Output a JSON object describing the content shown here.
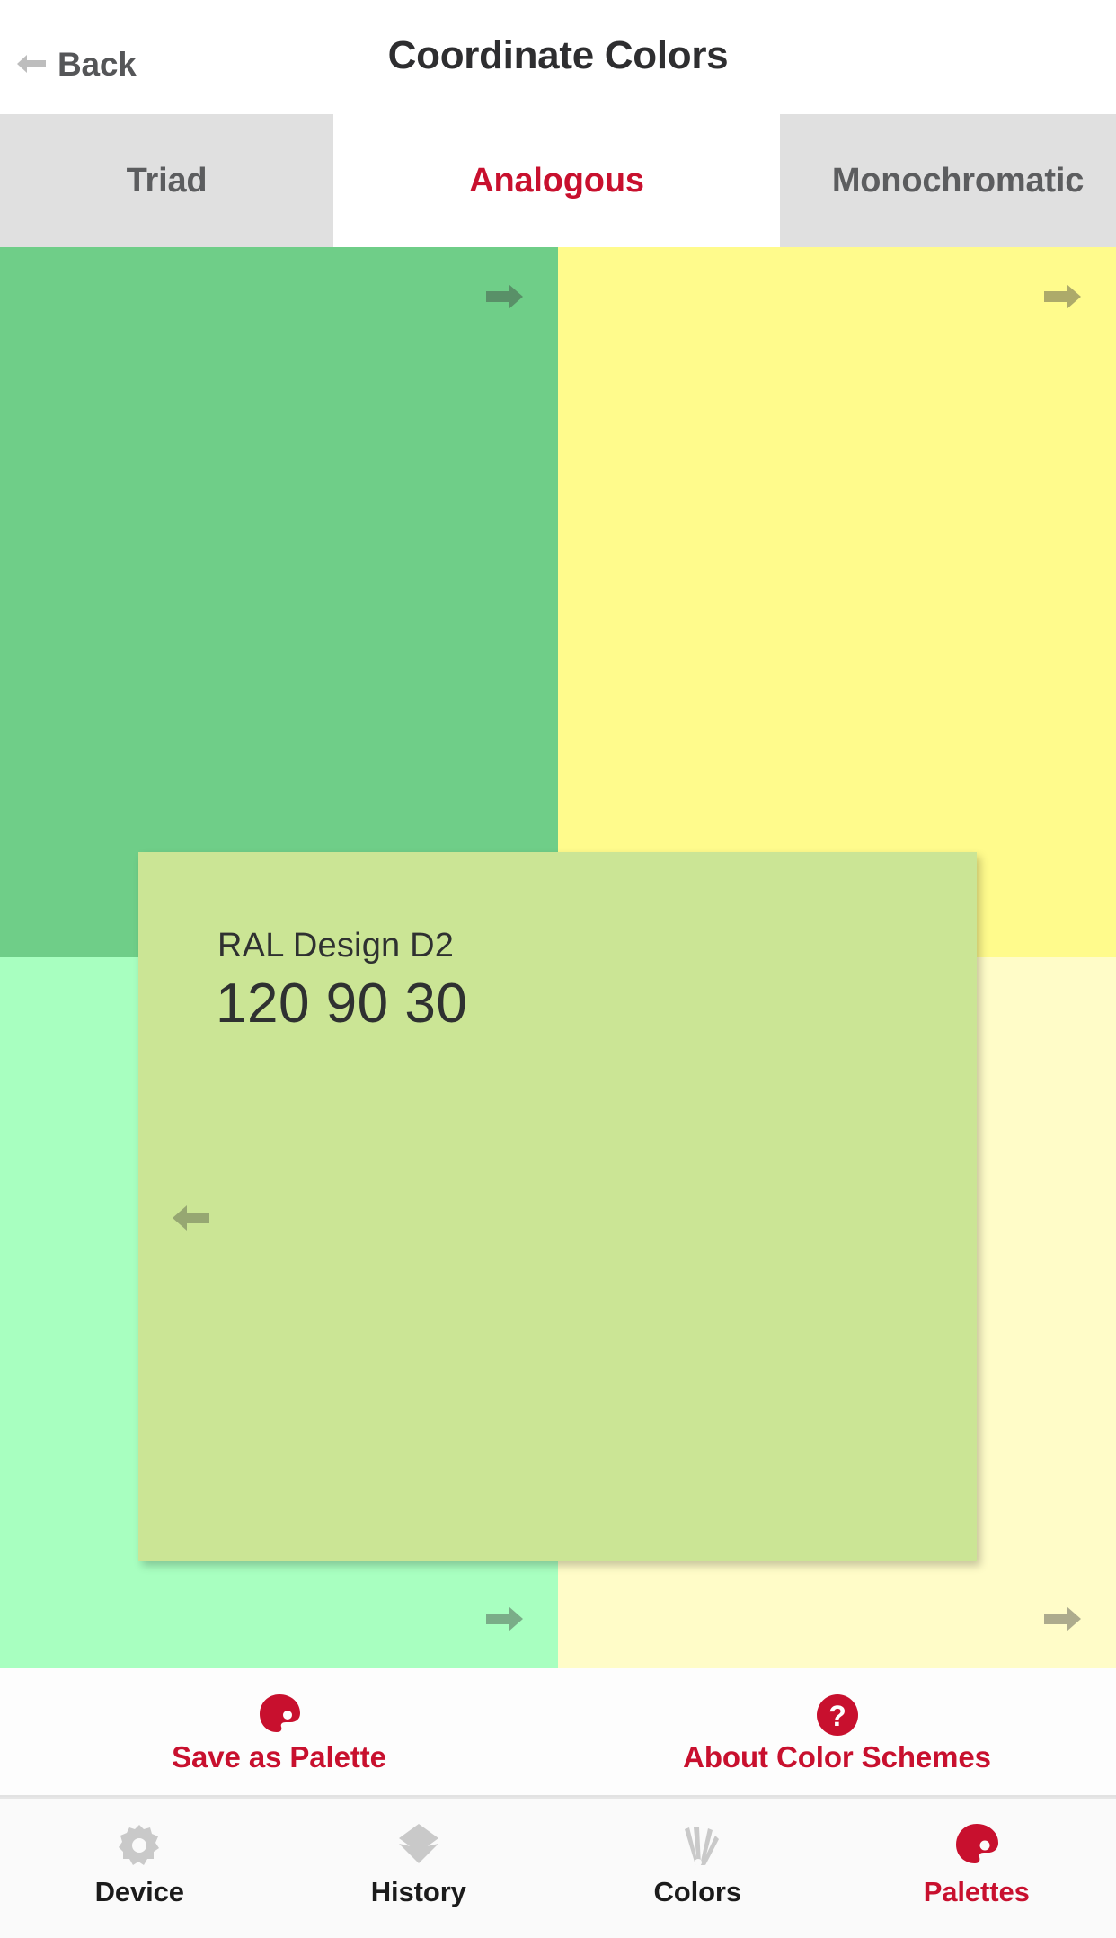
{
  "navbar": {
    "back_label": "Back",
    "back_icon": "arrow-left-icon",
    "title": "Coordinate Colors"
  },
  "tabs": [
    {
      "label": "Triad",
      "active": false
    },
    {
      "label": "Analogous",
      "active": true
    },
    {
      "label": "Monochromatic",
      "active": false
    }
  ],
  "colors": {
    "accent_red": "#c8102e",
    "inactive_tab_bg": "#e0e0e0",
    "inactive_tab_text": "#5c5d5f",
    "swatches": [
      {
        "position": "top-left",
        "hex": "#6FCE88",
        "arrow": "arrow-right-icon"
      },
      {
        "position": "top-right",
        "hex": "#FFFB8C",
        "arrow": "arrow-right-icon"
      },
      {
        "position": "bottom-left",
        "hex": "#A8FFC0",
        "arrow": "arrow-right-icon"
      },
      {
        "position": "bottom-right",
        "hex": "#FFFCC8",
        "arrow": "arrow-right-icon"
      }
    ]
  },
  "detail_card": {
    "system": "RAL Design D2",
    "code": "120 90 30",
    "hex": "#CBE595",
    "arrow": "arrow-left-icon"
  },
  "actions": [
    {
      "label": "Save as Palette",
      "icon": "palette-icon"
    },
    {
      "label": "About Color Schemes",
      "icon": "question-mark-icon"
    }
  ],
  "bottom_tabs": [
    {
      "label": "Device",
      "icon": "gear-icon",
      "selected": false
    },
    {
      "label": "History",
      "icon": "layers-icon",
      "selected": false
    },
    {
      "label": "Colors",
      "icon": "fan-deck-icon",
      "selected": false
    },
    {
      "label": "Palettes",
      "icon": "palette-icon",
      "selected": true
    }
  ]
}
